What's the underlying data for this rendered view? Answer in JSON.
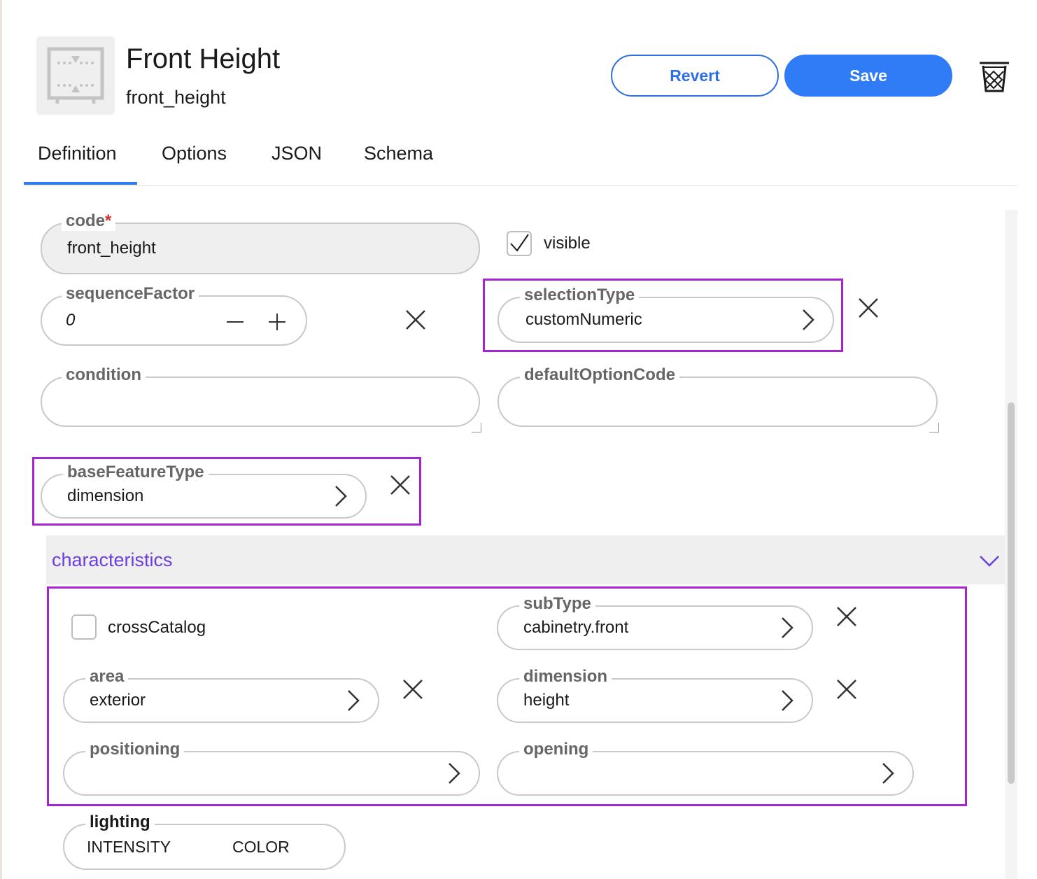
{
  "header": {
    "title": "Front Height",
    "code": "front_height",
    "thumbnail_icon": "dimension-height-icon",
    "revert_label": "Revert",
    "save_label": "Save",
    "delete_icon": "trash-icon"
  },
  "tabs": [
    {
      "label": "Definition",
      "active": true
    },
    {
      "label": "Options",
      "active": false
    },
    {
      "label": "JSON",
      "active": false
    },
    {
      "label": "Schema",
      "active": false
    }
  ],
  "form": {
    "code": {
      "label": "code",
      "required_mark": "*",
      "value": "front_height"
    },
    "visible": {
      "label": "visible",
      "checked": true
    },
    "sequenceFactor": {
      "label": "sequenceFactor",
      "value": "0"
    },
    "selectionType": {
      "label": "selectionType",
      "value": "customNumeric"
    },
    "condition": {
      "label": "condition",
      "value": ""
    },
    "defaultOptionCode": {
      "label": "defaultOptionCode",
      "value": ""
    },
    "baseFeatureType": {
      "label": "baseFeatureType",
      "value": "dimension"
    }
  },
  "characteristics": {
    "title": "characteristics",
    "crossCatalog": {
      "label": "crossCatalog",
      "checked": false
    },
    "subType": {
      "label": "subType",
      "value": "cabinetry.front"
    },
    "area": {
      "label": "area",
      "value": "exterior"
    },
    "dimension": {
      "label": "dimension",
      "value": "height"
    },
    "positioning": {
      "label": "positioning",
      "value": ""
    },
    "opening": {
      "label": "opening",
      "value": ""
    },
    "lighting": {
      "label": "lighting",
      "col1": "INTENSITY",
      "col2": "COLOR"
    }
  },
  "colors": {
    "primary": "#2f7cf6",
    "highlight": "#a524d4",
    "section_title": "#6b3fe0"
  }
}
